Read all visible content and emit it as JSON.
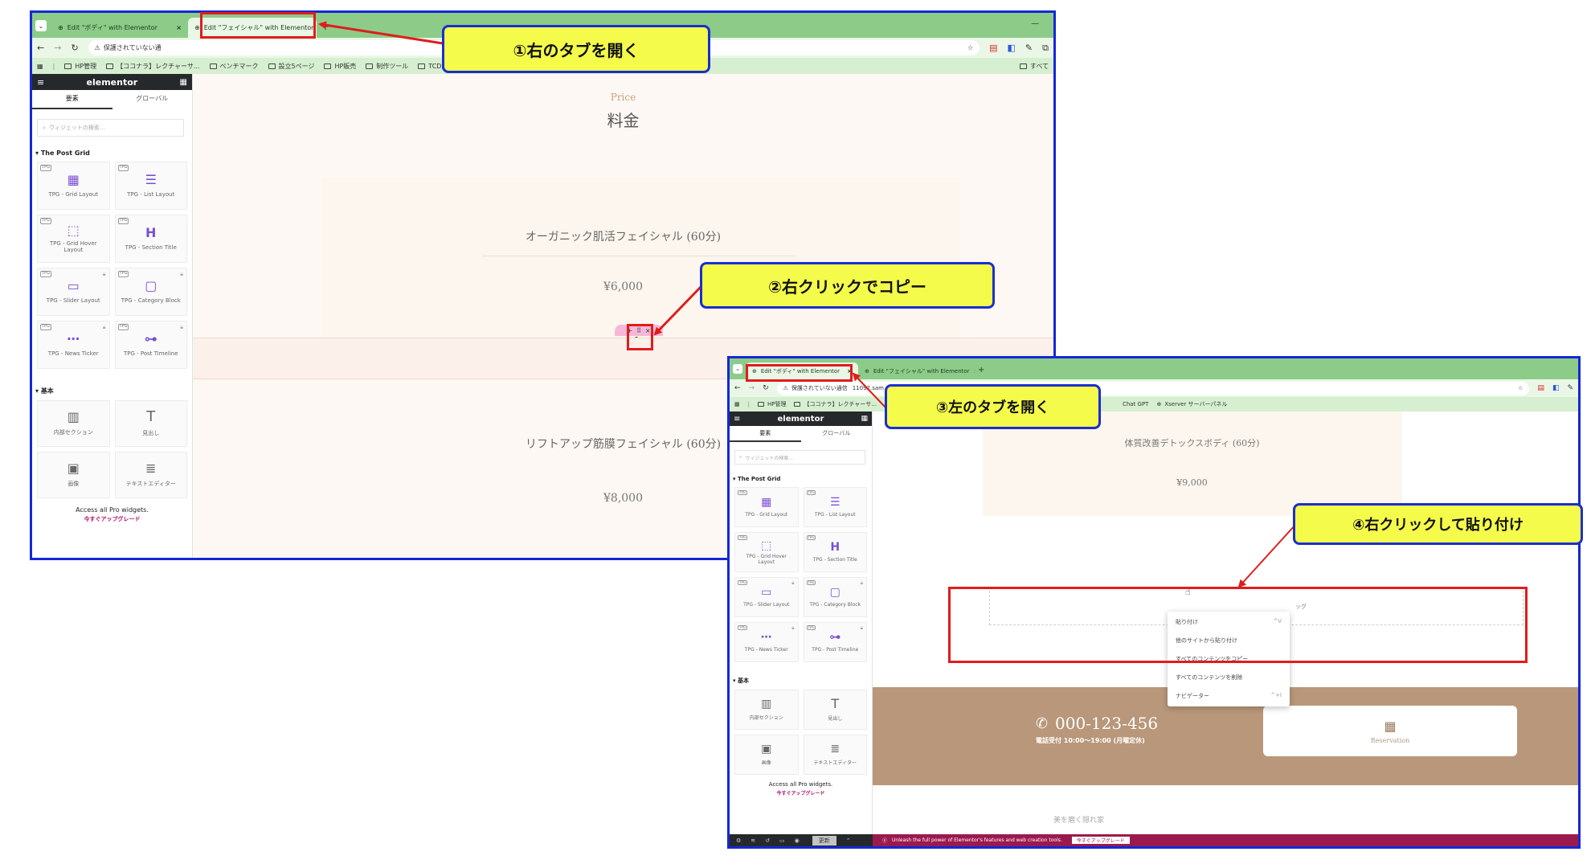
{
  "screenshot1": {
    "tabs": [
      {
        "label": "Edit \"ボディ\" with Elementor",
        "close": "×"
      },
      {
        "label": "Edit \"フェイシャル\" with Elementor",
        "close": "×"
      }
    ],
    "new_tab": "+",
    "address": "保護されていない通",
    "bookmarks": [
      "HP管理",
      "【ココナラ】レクチャーサ...",
      "ベンチマーク",
      "設立5ページ",
      "HP販売",
      "制作ツール",
      "TCD関係"
    ],
    "bookmarks_right": "すべて",
    "elementor": {
      "logo": "elementor",
      "tab_elements": "要素",
      "tab_global": "グローバル",
      "search_placeholder": "ウィジェットの検索...",
      "category_tpg": "The Post Grid",
      "tpg_widgets": [
        {
          "label": "TPG - Grid Layout",
          "icon": "grid-layout-icon",
          "glyph": "▦"
        },
        {
          "label": "TPG - List Layout",
          "icon": "list-layout-icon",
          "glyph": "☰"
        },
        {
          "label": "TPG - Grid Hover Layout",
          "icon": "grid-hover-icon",
          "glyph": "⬚"
        },
        {
          "label": "TPG - Section Title",
          "icon": "section-title-icon",
          "glyph": "H"
        },
        {
          "label": "TPG - Slider Layout",
          "icon": "slider-icon",
          "glyph": "▭"
        },
        {
          "label": "TPG - Category Block",
          "icon": "category-block-icon",
          "glyph": "▢"
        },
        {
          "label": "TPG - News Ticker",
          "icon": "news-ticker-icon",
          "glyph": "⋯"
        },
        {
          "label": "TPG - Post Timeline",
          "icon": "timeline-icon",
          "glyph": "⊶"
        }
      ],
      "tpg_tag": "TPG",
      "category_basic": "基本",
      "basic_widgets": [
        {
          "label": "内部セクション",
          "icon": "inner-section-icon",
          "glyph": "▥"
        },
        {
          "label": "見出し",
          "icon": "heading-icon",
          "glyph": "T"
        },
        {
          "label": "画像",
          "icon": "image-icon",
          "glyph": "▣"
        },
        {
          "label": "テキストエディター",
          "icon": "text-editor-icon",
          "glyph": "≣"
        }
      ],
      "access_pro": "Access all Pro widgets.",
      "upgrade": "今すぐアップグレード"
    },
    "canvas": {
      "price_en": "Price",
      "price_jp": "料金",
      "item1_name": "オーガニック肌活フェイシャル (60分)",
      "item1_price": "¥6,000",
      "item2_name": "リフトアップ筋膜フェイシャル (60分)",
      "item2_price": "¥8,000"
    }
  },
  "screenshot2": {
    "tabs": [
      {
        "label": "Edit \"ボディ\" with Elementor",
        "close": "×"
      },
      {
        "label": "Edit \"フェイシャル\" with Elementor",
        "close": "×"
      }
    ],
    "new_tab": "+",
    "address": "保護されていない通信",
    "address_url": "11092.sam",
    "bookmarks": [
      "HP管理",
      "【ココナラ】レクチャーサ..."
    ],
    "bookmarks_right": [
      "Chat GPT",
      "Xserver サーバーパネル"
    ],
    "elementor": {
      "logo": "elementor",
      "tab_elements": "要素",
      "tab_global": "グローバル",
      "search_placeholder": "ウィジェットの検索...",
      "category_tpg": "The Post Grid",
      "category_basic": "基本",
      "access_pro": "Access all Pro widgets.",
      "upgrade": "今すぐアップグレード",
      "update_button": "更新"
    },
    "canvas": {
      "item_name": "体質改善デトックスボディ (60分)",
      "item_price": "¥9,000",
      "drop_hint": "ッグ",
      "phone": "000-123-456",
      "hours": "電話受付 10:00〜19:00 (月曜定休)",
      "reservation": "Reservation",
      "footer_text": "美を磨く隠れ家"
    },
    "context_menu": [
      {
        "label": "貼り付け",
        "shortcut": "^V"
      },
      {
        "label": "他のサイトから貼り付け",
        "shortcut": ""
      },
      {
        "label": "すべてのコンテンツをコピー",
        "shortcut": ""
      },
      {
        "label": "すべてのコンテンツを削除",
        "shortcut": ""
      },
      {
        "label": "ナビゲーター",
        "shortcut": "^+I"
      }
    ],
    "notice": "Unleash the full power of Elementor's features and web creation tools.",
    "notice_button": "今すぐアップグレード"
  },
  "callouts": [
    "①右のタブを開く",
    "②右クリックでコピー",
    "③左のタブを開く",
    "④右クリックして貼り付け"
  ],
  "colors": {
    "frame_border": "#1428d6",
    "callout_bg": "#f4fb4a",
    "highlight_red": "#e01c1c",
    "tab_strip": "#8ccc88",
    "contact_band": "#b8977a",
    "notice_bar": "#9b1a4d"
  }
}
